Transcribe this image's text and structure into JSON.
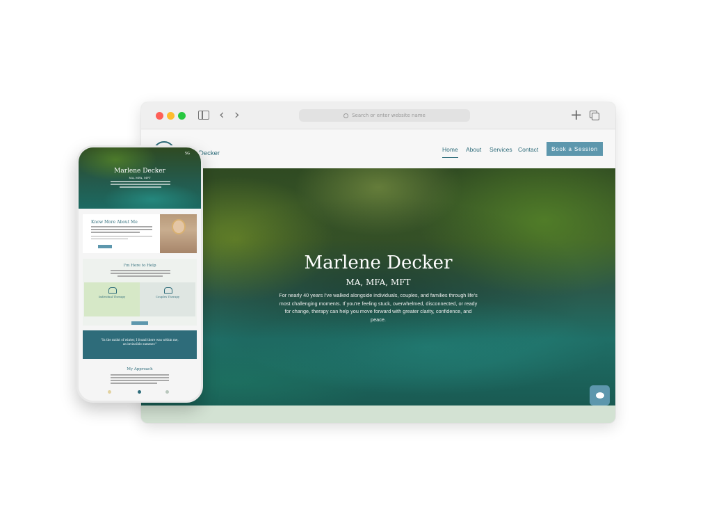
{
  "browser": {
    "address_placeholder": "Search or enter website name"
  },
  "site": {
    "logo_text": "Decker",
    "nav": [
      "Home",
      "About",
      "Services",
      "Contact"
    ],
    "book_button": "Book a Session",
    "hero": {
      "title": "Marlene Decker",
      "credentials": "MA, MFA, MFT",
      "body": "For nearly 40 years I've walked alongside individuals, couples, and families through life's most challenging moments. If you're feeling stuck, overwhelmed, disconnected, or ready for change, therapy can help you move forward with greater clarity, confidence, and peace."
    }
  },
  "mobile": {
    "status": "5G",
    "hero_title": "Marlene Decker",
    "hero_sub": "MA, MFA, MFT",
    "about_title": "Know More About Me",
    "help_title": "I'm Here to Help",
    "card1_title": "Individual Therapy",
    "card2_title": "Couples Therapy",
    "quote": "\"In the midst of winter, I found there was within me, an invincible summer.\"",
    "approach_title": "My Approach"
  },
  "colors": {
    "accent": "#2e6c7a",
    "button": "#5d97ad",
    "light_card": "#d6e8c7"
  }
}
